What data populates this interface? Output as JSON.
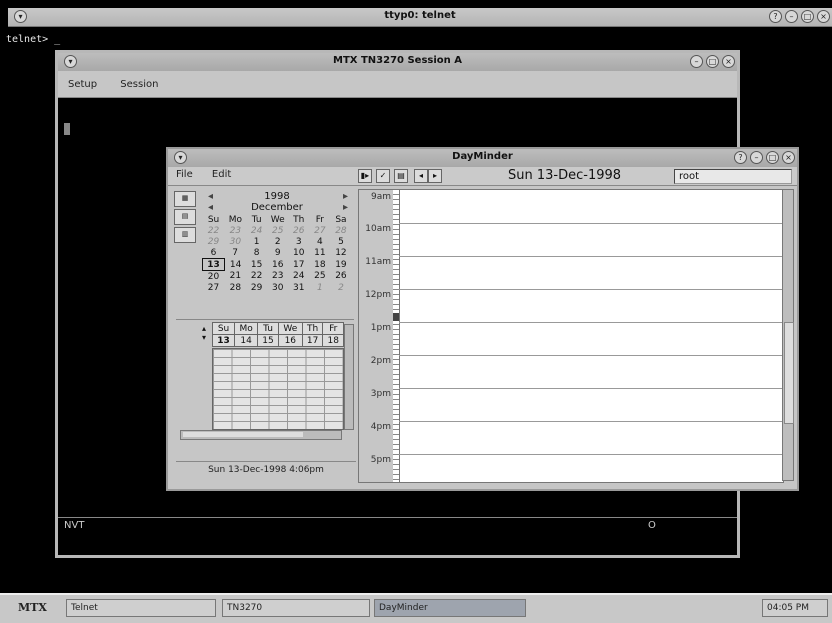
{
  "telnet": {
    "title": "ttyp0: telnet",
    "prompt": "telnet> _"
  },
  "tn3270": {
    "title": "MTX TN3270 Session A",
    "menu": [
      "Setup",
      "Session"
    ],
    "status_left": "NVT",
    "status_right": "O"
  },
  "dayminder": {
    "title": "DayMinder",
    "menu": [
      "File",
      "Edit"
    ],
    "date_display": "Sun 13-Dec-1998",
    "user": "root",
    "calendar": {
      "year": "1998",
      "month": "December",
      "weekdays": [
        "Su",
        "Mo",
        "Tu",
        "We",
        "Th",
        "Fr",
        "Sa"
      ],
      "weeks": [
        [
          "22",
          "23",
          "24",
          "25",
          "26",
          "27",
          "28"
        ],
        [
          "29",
          "30",
          "1",
          "2",
          "3",
          "4",
          "5"
        ],
        [
          "6",
          "7",
          "8",
          "9",
          "10",
          "11",
          "12"
        ],
        [
          "13",
          "14",
          "15",
          "16",
          "17",
          "18",
          "19"
        ],
        [
          "20",
          "21",
          "22",
          "23",
          "24",
          "25",
          "26"
        ],
        [
          "27",
          "28",
          "29",
          "30",
          "31",
          "1",
          "2"
        ]
      ],
      "today": "13"
    },
    "week_view": {
      "days": [
        "Su",
        "Mo",
        "Tu",
        "We",
        "Th",
        "Fr"
      ],
      "dates": [
        "13",
        "14",
        "15",
        "16",
        "17",
        "18"
      ]
    },
    "status": "Sun 13-Dec-1998 4:06pm",
    "hours": [
      "9am",
      "10am",
      "11am",
      "12pm",
      "1pm",
      "2pm",
      "3pm",
      "4pm",
      "5pm"
    ]
  },
  "taskbar": {
    "logo": "MTX",
    "items": [
      "Telnet",
      "TN3270",
      "DayMinder"
    ],
    "clock": "04:05 PM"
  }
}
